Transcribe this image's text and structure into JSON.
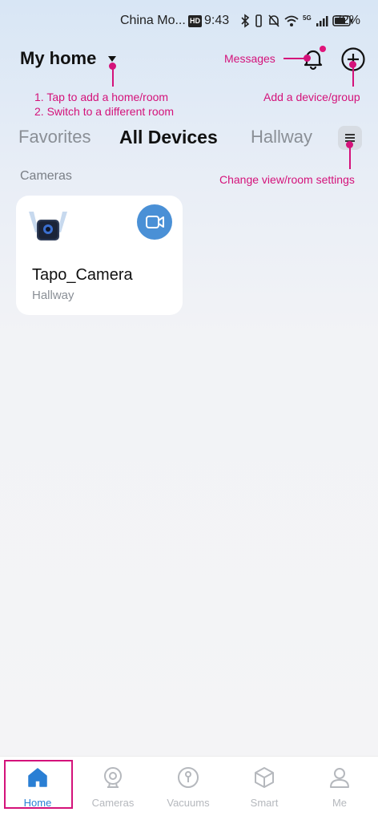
{
  "status_bar": {
    "carrier": "China Mo...",
    "hd_badge": "HD",
    "time": "9:43",
    "network": "5G",
    "battery": "72%"
  },
  "header": {
    "home_name": "My home"
  },
  "annotations": {
    "messages": "Messages",
    "add_home_line1": "1. Tap to add a home/room",
    "add_home_line2": "2. Switch to a different room",
    "add_device": "Add a device/group",
    "change_view": "Change view/room settings"
  },
  "tabs": [
    {
      "label": "Favorites",
      "active": false
    },
    {
      "label": "All Devices",
      "active": true
    },
    {
      "label": "Hallway",
      "active": false
    }
  ],
  "section": {
    "label": "Cameras"
  },
  "devices": [
    {
      "name": "Tapo_Camera",
      "room": "Hallway",
      "icon": "video-camera-icon"
    }
  ],
  "bottom_nav": [
    {
      "label": "Home",
      "icon": "home-icon",
      "active": true
    },
    {
      "label": "Cameras",
      "icon": "camera-icon",
      "active": false
    },
    {
      "label": "Vacuums",
      "icon": "vacuum-icon",
      "active": false
    },
    {
      "label": "Smart",
      "icon": "cube-icon",
      "active": false
    },
    {
      "label": "Me",
      "icon": "person-icon",
      "active": false
    }
  ],
  "colors": {
    "accent": "#2a7fd4",
    "annotation": "#d4127a",
    "live_button": "#4a90d6"
  }
}
